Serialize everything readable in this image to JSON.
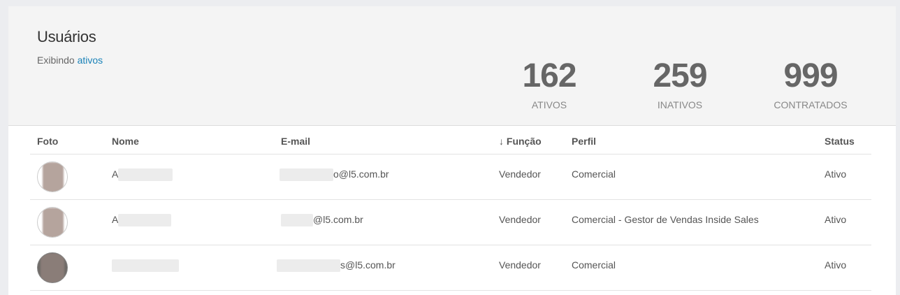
{
  "header": {
    "title": "Usuários",
    "subtitle_prefix": "Exibindo",
    "subtitle_link": "ativos"
  },
  "stats": [
    {
      "value": "162",
      "label": "ATIVOS"
    },
    {
      "value": "259",
      "label": "INATIVOS"
    },
    {
      "value": "999",
      "label": "CONTRATADOS"
    }
  ],
  "table": {
    "columns": {
      "foto": "Foto",
      "nome": "Nome",
      "email": "E-mail",
      "funcao": "↓ Função",
      "perfil": "Perfil",
      "status": "Status"
    },
    "rows": [
      {
        "name_initial": "A",
        "email_visible": "o@l5.com.br",
        "funcao": "Vendedor",
        "perfil": "Comercial",
        "status": "Ativo"
      },
      {
        "name_initial": "A",
        "email_visible": "@l5.com.br",
        "funcao": "Vendedor",
        "perfil": "Comercial - Gestor de Vendas Inside Sales",
        "status": "Ativo"
      },
      {
        "name_initial": "",
        "email_visible": "s@l5.com.br",
        "funcao": "Vendedor",
        "perfil": "Comercial",
        "status": "Ativo"
      }
    ]
  }
}
